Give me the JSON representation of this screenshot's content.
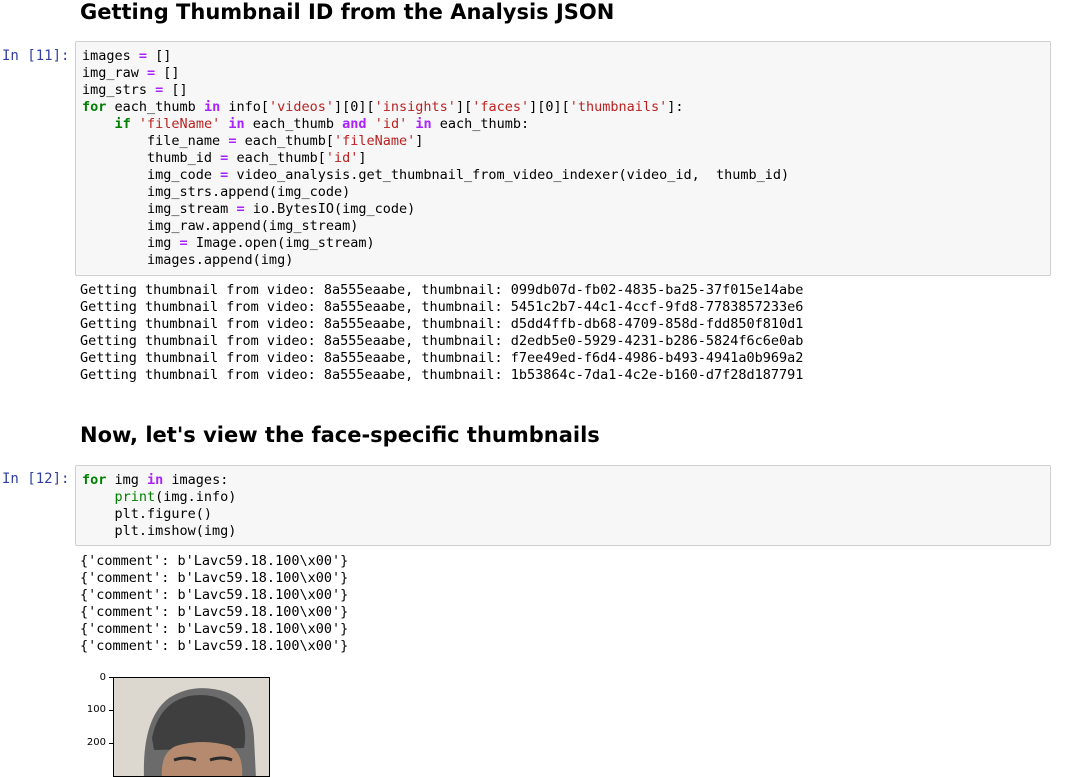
{
  "cells": [
    {
      "heading": "Getting Thumbnail ID from the Analysis JSON"
    },
    {
      "prompt": "In [11]:",
      "output_lines": [
        "Getting thumbnail from video: 8a555eaabe, thumbnail: 099db07d-fb02-4835-ba25-37f015e14abe",
        "Getting thumbnail from video: 8a555eaabe, thumbnail: 5451c2b7-44c1-4ccf-9fd8-7783857233e6",
        "Getting thumbnail from video: 8a555eaabe, thumbnail: d5dd4ffb-db68-4709-858d-fdd850f810d1",
        "Getting thumbnail from video: 8a555eaabe, thumbnail: d2edb5e0-5929-4231-b286-5824f6c6e0ab",
        "Getting thumbnail from video: 8a555eaabe, thumbnail: f7ee49ed-f6d4-4986-b493-4941a0b969a2",
        "Getting thumbnail from video: 8a555eaabe, thumbnail: 1b53864c-7da1-4c2e-b160-d7f28d187791"
      ]
    },
    {
      "heading": "Now, let's view the face-specific thumbnails"
    },
    {
      "prompt": "In [12]:",
      "output_lines": [
        "{'comment': b'Lavc59.18.100\\x00'}",
        "{'comment': b'Lavc59.18.100\\x00'}",
        "{'comment': b'Lavc59.18.100\\x00'}",
        "{'comment': b'Lavc59.18.100\\x00'}",
        "{'comment': b'Lavc59.18.100\\x00'}",
        "{'comment': b'Lavc59.18.100\\x00'}"
      ],
      "plot_y_ticks": [
        "0",
        "100",
        "200"
      ]
    }
  ],
  "code_tokens": {
    "c11": [
      [
        [
          "images ",
          ""
        ],
        [
          "=",
          "op"
        ],
        [
          " []",
          ""
        ]
      ],
      [
        [
          "img_raw ",
          ""
        ],
        [
          "=",
          "op"
        ],
        [
          " []",
          ""
        ]
      ],
      [
        [
          "img_strs ",
          ""
        ],
        [
          "=",
          "op"
        ],
        [
          " []",
          ""
        ]
      ],
      [
        [
          "for",
          "kw"
        ],
        [
          " each_thumb ",
          ""
        ],
        [
          "in",
          "op"
        ],
        [
          " info[",
          ""
        ],
        [
          "'videos'",
          "str"
        ],
        [
          "][0][",
          ""
        ],
        [
          "'insights'",
          "str"
        ],
        [
          "][",
          ""
        ],
        [
          "'faces'",
          "str"
        ],
        [
          "][0][",
          ""
        ],
        [
          "'thumbnails'",
          "str"
        ],
        [
          "]:",
          ""
        ]
      ],
      [
        [
          "    ",
          ""
        ],
        [
          "if",
          "kw"
        ],
        [
          " ",
          ""
        ],
        [
          "'fileName'",
          "str"
        ],
        [
          " ",
          ""
        ],
        [
          "in",
          "op"
        ],
        [
          " each_thumb ",
          ""
        ],
        [
          "and",
          "op"
        ],
        [
          " ",
          ""
        ],
        [
          "'id'",
          "str"
        ],
        [
          " ",
          ""
        ],
        [
          "in",
          "op"
        ],
        [
          " each_thumb:",
          ""
        ]
      ],
      [
        [
          "        file_name ",
          ""
        ],
        [
          "=",
          "op"
        ],
        [
          " each_thumb[",
          ""
        ],
        [
          "'fileName'",
          "str"
        ],
        [
          "]",
          ""
        ]
      ],
      [
        [
          "        thumb_id ",
          ""
        ],
        [
          "=",
          "op"
        ],
        [
          " each_thumb[",
          ""
        ],
        [
          "'id'",
          "str"
        ],
        [
          "]",
          ""
        ]
      ],
      [
        [
          "        img_code ",
          ""
        ],
        [
          "=",
          "op"
        ],
        [
          " video_analysis.get_thumbnail_from_video_indexer(video_id,  thumb_id)",
          ""
        ]
      ],
      [
        [
          "        img_strs.append(img_code)",
          ""
        ]
      ],
      [
        [
          "        img_stream ",
          ""
        ],
        [
          "=",
          "op"
        ],
        [
          " io.BytesIO(img_code)",
          ""
        ]
      ],
      [
        [
          "        img_raw.append(img_stream)",
          ""
        ]
      ],
      [
        [
          "        img ",
          ""
        ],
        [
          "=",
          "op"
        ],
        [
          " Image.open(img_stream)",
          ""
        ]
      ],
      [
        [
          "        images.append(img)",
          ""
        ]
      ]
    ],
    "c12": [
      [
        [
          "for",
          "kw"
        ],
        [
          " img ",
          ""
        ],
        [
          "in",
          "op"
        ],
        [
          " images:",
          ""
        ]
      ],
      [
        [
          "    ",
          ""
        ],
        [
          "print",
          "bi"
        ],
        [
          "(img.info)",
          ""
        ]
      ],
      [
        [
          "    plt.figure()",
          ""
        ]
      ],
      [
        [
          "    plt.imshow(img)",
          ""
        ]
      ]
    ]
  }
}
